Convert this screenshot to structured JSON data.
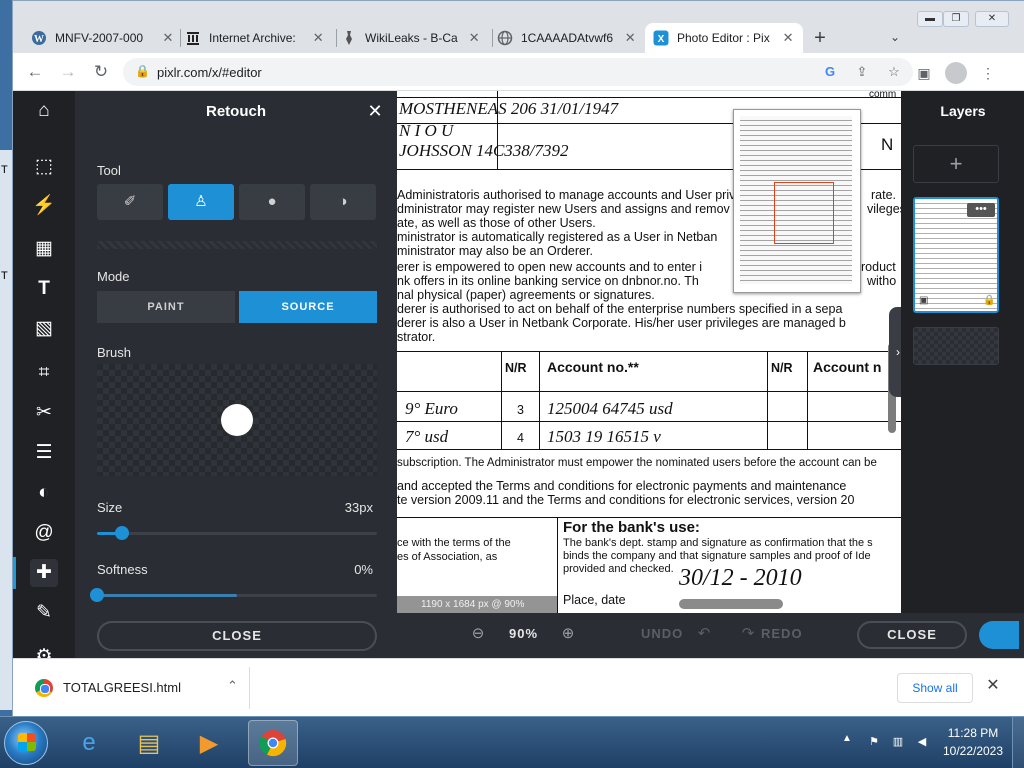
{
  "browser": {
    "tabs": [
      {
        "title": "MNFV-2007-000",
        "icon": "wordpress-icon"
      },
      {
        "title": "Internet Archive:",
        "icon": "archive-icon"
      },
      {
        "title": "WikiLeaks - B-Ca",
        "icon": "wikileaks-icon"
      },
      {
        "title": "1CAAAADAtvwf6",
        "icon": "globe-icon"
      },
      {
        "title": "Photo Editor : Pix",
        "icon": "pixlr-icon",
        "active": true
      }
    ],
    "new_tab": "+",
    "url": "pixlr.com/x/#editor"
  },
  "app": {
    "panel": {
      "title": "Retouch",
      "tool_label": "Tool",
      "tools": [
        "bandage-icon",
        "stamp-icon",
        "drop-icon",
        "sponge-icon"
      ],
      "mode_label": "Mode",
      "modes": [
        "PAINT",
        "SOURCE"
      ],
      "active_mode": "SOURCE",
      "brush_label": "Brush",
      "size_label": "Size",
      "size_value": "33px",
      "size_fraction": 0.09,
      "softness_label": "Softness",
      "softness_value": "0%",
      "softness_fraction": 0.0,
      "close_label": "CLOSE"
    },
    "layers_title": "Layers",
    "add_layer": "+",
    "doc_info": "1190 x 1684 px @ 90%",
    "zoom": "90%",
    "undo": "UNDO",
    "redo": "REDO",
    "close_label": "CLOSE"
  },
  "document": {
    "lines": [
      "MOSTHENEAS  206  31/01/1947",
      "N I O U",
      "JOHSSON   14C338/7392",
      "Administratoris authorised to manage accounts and User privil",
      "dministrator may register new Users and assigns and remov",
      "ate, as well as those of other Users.",
      "ministrator is automatically registered as a User in Netban",
      "ministrator may also be an Orderer.",
      "erer is empowered to open new accounts and to enter i",
      "nk offers in its online banking service on dnbnor.no. Th",
      "nal physical (paper) agreements or signatures.",
      "derer is authorised to act on behalf of the enterprise numbers specified in a sepa",
      "derer is also a User in Netbank Corporate. His/her user privileges are managed b",
      "strator.",
      "subscription. The Administrator must empower the nominated users before the account can be",
      "and accepted the Terms and conditions for electronic payments and maintenance",
      "te version 2009.11 and the Terms and conditions for electronic services, version 20",
      "ce with the terms of the",
      "es of Association, as",
      "For the bank's use:",
      "The bank's dept. stamp and signature as confirmation that the s",
      "binds the company and that signature samples and proof of Ide",
      "provided and checked.",
      "Place, date",
      "30/12 - 2010",
      "rate.",
      "vileges",
      "roduct",
      "witho",
      "N",
      "comm"
    ],
    "table_headers": [
      "N/R",
      "Account no.**",
      "N/R",
      "Account n"
    ],
    "table_rows": [
      {
        "left": "9° Euro",
        "nr": "3",
        "account": "125004 64745 usd"
      },
      {
        "left": "7° usd",
        "nr": "4",
        "account": "1503 19 16515 v"
      }
    ]
  },
  "downloads": {
    "file": "TOTALGREESI.html",
    "show_all": "Show all"
  },
  "taskbar": {
    "time": "11:28 PM",
    "date": "10/22/2023"
  },
  "desktop_edge": [
    "T",
    "T"
  ]
}
